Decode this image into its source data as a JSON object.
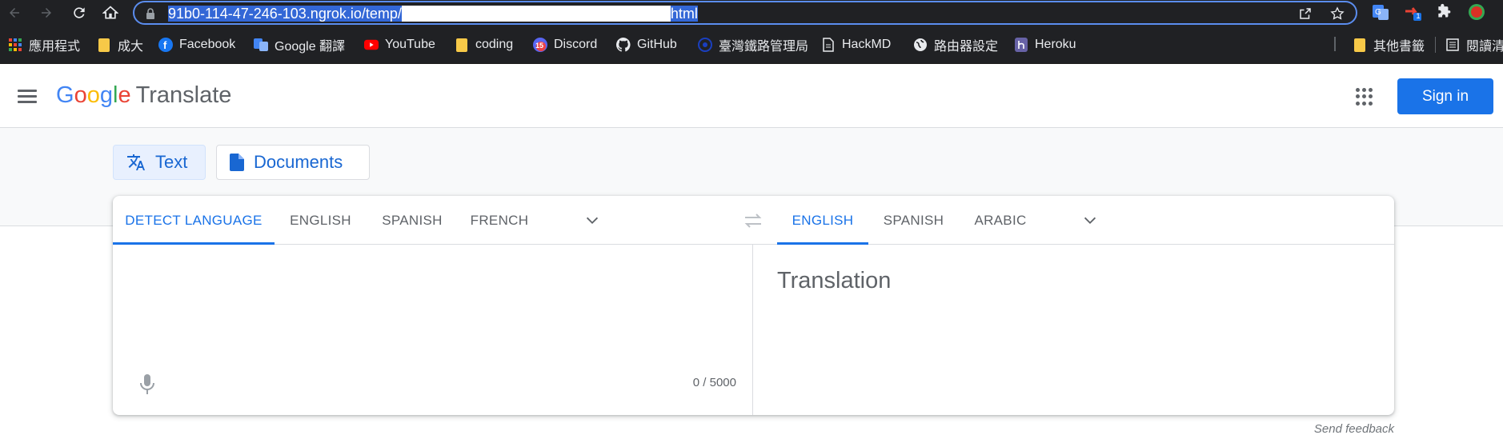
{
  "browser": {
    "url_prefix": "91b0-114-47-246-103.ngrok.io/temp/",
    "url_suffix": "html",
    "bookmarks": [
      {
        "label": "應用程式",
        "icon": "apps-grid-icon"
      },
      {
        "label": "成大",
        "icon": "folder-icon"
      },
      {
        "label": "Facebook",
        "icon": "facebook-icon"
      },
      {
        "label": "Google 翻譯",
        "icon": "google-translate-icon"
      },
      {
        "label": "YouTube",
        "icon": "youtube-icon"
      },
      {
        "label": "coding",
        "icon": "folder-icon"
      },
      {
        "label": "Discord",
        "icon": "discord-icon",
        "badge": "15"
      },
      {
        "label": "GitHub",
        "icon": "github-icon"
      },
      {
        "label": "臺灣鐵路管理局",
        "icon": "railway-icon"
      },
      {
        "label": "HackMD",
        "icon": "document-icon"
      },
      {
        "label": "路由器設定",
        "icon": "globe-icon"
      },
      {
        "label": "Heroku",
        "icon": "heroku-icon"
      },
      {
        "label": "其他書籤",
        "icon": "folder-icon"
      },
      {
        "label": "閱讀清",
        "icon": "reading-list-icon"
      }
    ],
    "extension_badge": "1"
  },
  "header": {
    "logo_letters": [
      "G",
      "o",
      "o",
      "g",
      "l",
      "e"
    ],
    "product": "Translate",
    "signin_label": "Sign in"
  },
  "modes": {
    "text_label": "Text",
    "documents_label": "Documents"
  },
  "source_langs": [
    "DETECT LANGUAGE",
    "ENGLISH",
    "SPANISH",
    "FRENCH"
  ],
  "target_langs": [
    "ENGLISH",
    "SPANISH",
    "ARABIC"
  ],
  "source": {
    "counter": "0 / 5000"
  },
  "target": {
    "placeholder": "Translation"
  },
  "footer": {
    "feedback_label": "Send feedback"
  },
  "colors": {
    "accent": "#1a73e8",
    "chrome_bg": "#202124"
  }
}
